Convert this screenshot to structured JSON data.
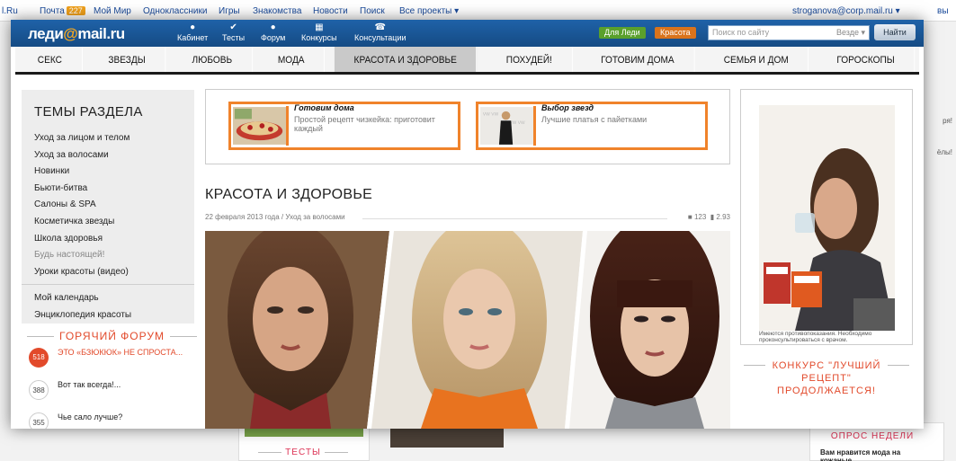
{
  "topbar": {
    "links": [
      "l.Ru",
      "Почта",
      "Мой Мир",
      "Одноклассники",
      "Игры",
      "Знакомства",
      "Новости",
      "Поиск",
      "Все проекты ▾"
    ],
    "mail_count": "227",
    "user": "stroganova@corp.mail.ru ▾",
    "logout": "вы"
  },
  "header": {
    "logo_a": "леди",
    "logo_at": "@",
    "logo_b": "mail",
    "logo_c": ".ru",
    "nav": [
      "Кабинет",
      "Тесты",
      "Форум",
      "Конкурсы",
      "Консультации"
    ],
    "tag_green": "Для Леди",
    "tag_orange": "Красота",
    "search_placeholder": "Поиск по сайту",
    "search_scope": "Везде ▾",
    "search_button": "Найти"
  },
  "mainnav": [
    "СЕКС",
    "ЗВЕЗДЫ",
    "ЛЮБОВЬ",
    "МОДА",
    "КРАСОТА И ЗДОРОВЬЕ",
    "ПОХУДЕЙ!",
    "ГОТОВИМ ДОМА",
    "СЕМЬЯ И ДОМ",
    "ГОРОСКОПЫ"
  ],
  "sidebar": {
    "title": "ТЕМЫ РАЗДЕЛА",
    "items": [
      "Уход за лицом и телом",
      "Уход за волосами",
      "Новинки",
      "Бьюти-битва",
      "Салоны & SPA",
      "Косметичка звезды",
      "Школа здоровья",
      "Будь настоящей!",
      "Уроки красоты (видео)"
    ],
    "extra": [
      "Мой календарь",
      "Энциклопедия красоты"
    ]
  },
  "forum": {
    "title": "ГОРЯЧИЙ ФОРУМ",
    "rows": [
      {
        "count": "518",
        "text": "ЭТО «БЗЮКЮК» НЕ СПРОСТА..."
      },
      {
        "count": "388",
        "text": "Вот так всегда!..."
      },
      {
        "count": "355",
        "text": "Чье сало лучше?"
      }
    ]
  },
  "promo": [
    {
      "title": "Готовим дома",
      "desc": "Простой рецепт чизкейка: приготовит каждый"
    },
    {
      "title": "Выбор звезд",
      "desc": "Лучшие платья с пайетками"
    }
  ],
  "article": {
    "title": "КРАСОТА И ЗДОРОВЬЕ",
    "meta": "22 февраля 2013 года / Уход за волосами",
    "comments": "123",
    "rating": "2.93"
  },
  "ad": {
    "note": "Имеются противопоказания. Необходимо проконсультироваться с врачом."
  },
  "contest": {
    "title": "КОНКУРС \"ЛУЧШИЙ\nРЕЦЕПТ\"\nПРОДОЛЖАЕТСЯ!"
  },
  "background": {
    "tests": "ТЕСТЫ",
    "poll": "ОПРОС НЕДЕЛИ",
    "poll_q": "Вам нравится мода на кожаные",
    "side1": "ря!",
    "side2": "ёлы!"
  },
  "colors": {
    "header_blue": "#1a5797",
    "accent_orange": "#f0832b",
    "forum_red": "#e24a2b",
    "tag_green": "#5aa02c",
    "tag_orange": "#d9731c"
  }
}
